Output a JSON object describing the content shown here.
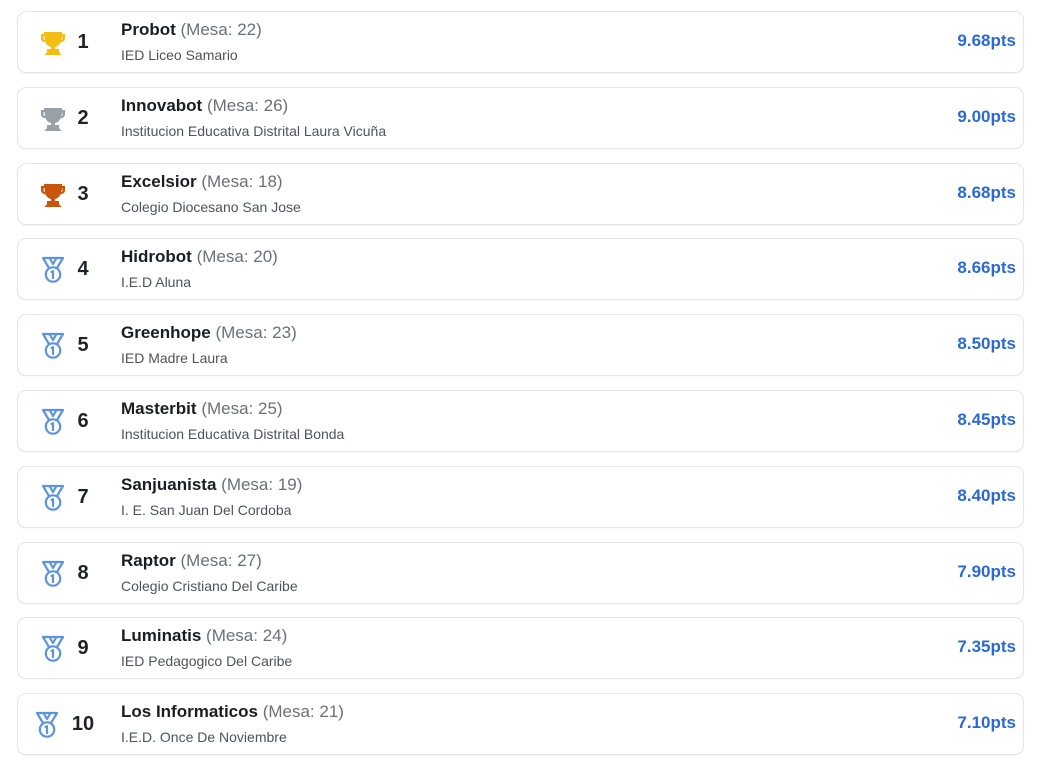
{
  "colors": {
    "gold": "#f3bd14",
    "silver": "#9aa0a8",
    "bronze": "#c8560b",
    "medal": "#5b93e0",
    "score": "#2a69d6"
  },
  "rankings": [
    {
      "rank": "1",
      "team": "Probot",
      "mesa": "(Mesa: 22)",
      "school": "IED Liceo Samario",
      "score": "9.68pts",
      "icon": "gold-trophy-icon"
    },
    {
      "rank": "2",
      "team": "Innovabot",
      "mesa": "(Mesa: 26)",
      "school": "Institucion Educativa Distrital Laura Vicuña",
      "score": "9.00pts",
      "icon": "silver-trophy-icon"
    },
    {
      "rank": "3",
      "team": "Excelsior",
      "mesa": "(Mesa: 18)",
      "school": "Colegio Diocesano San Jose",
      "score": "8.68pts",
      "icon": "bronze-trophy-icon"
    },
    {
      "rank": "4",
      "team": "Hidrobot",
      "mesa": "(Mesa: 20)",
      "school": "I.E.D Aluna",
      "score": "8.66pts",
      "icon": "medal-icon"
    },
    {
      "rank": "5",
      "team": "Greenhope",
      "mesa": "(Mesa: 23)",
      "school": "IED Madre Laura",
      "score": "8.50pts",
      "icon": "medal-icon"
    },
    {
      "rank": "6",
      "team": "Masterbit",
      "mesa": "(Mesa: 25)",
      "school": "Institucion Educativa Distrital Bonda",
      "score": "8.45pts",
      "icon": "medal-icon"
    },
    {
      "rank": "7",
      "team": "Sanjuanista",
      "mesa": "(Mesa: 19)",
      "school": "I. E. San Juan Del Cordoba",
      "score": "8.40pts",
      "icon": "medal-icon"
    },
    {
      "rank": "8",
      "team": "Raptor",
      "mesa": "(Mesa: 27)",
      "school": "Colegio Cristiano Del Caribe",
      "score": "7.90pts",
      "icon": "medal-icon"
    },
    {
      "rank": "9",
      "team": "Luminatis",
      "mesa": "(Mesa: 24)",
      "school": "IED Pedagogico Del Caribe",
      "score": "7.35pts",
      "icon": "medal-icon"
    },
    {
      "rank": "10",
      "team": "Los Informaticos",
      "mesa": "(Mesa: 21)",
      "school": "I.E.D. Once De Noviembre",
      "score": "7.10pts",
      "icon": "medal-icon"
    }
  ]
}
